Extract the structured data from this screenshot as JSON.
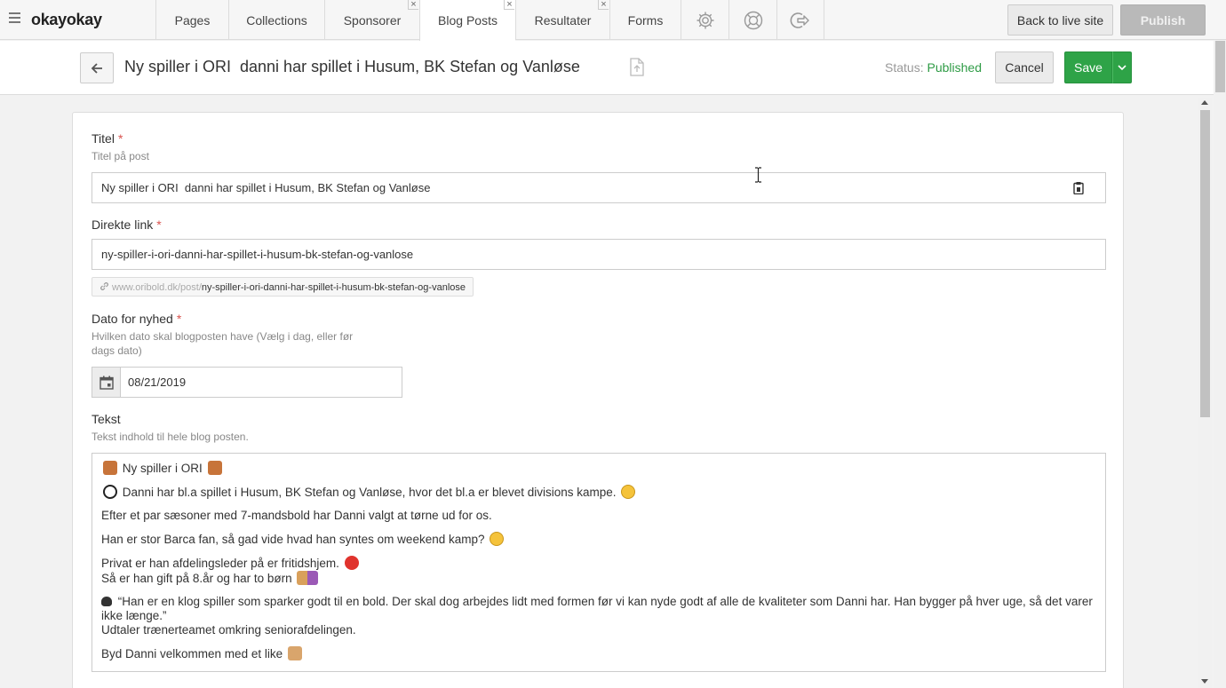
{
  "brand": "okayokay",
  "tabs": [
    {
      "label": "Pages",
      "closable": false
    },
    {
      "label": "Collections",
      "closable": false
    },
    {
      "label": "Sponsorer",
      "closable": true
    },
    {
      "label": "Blog Posts",
      "closable": true,
      "active": true
    },
    {
      "label": "Resultater",
      "closable": true
    },
    {
      "label": "Forms",
      "closable": false
    }
  ],
  "tab_icons": [
    "gear-icon",
    "lifebuoy-icon",
    "logout-icon"
  ],
  "top_actions": {
    "back_to_live": "Back to live site",
    "publish": "Publish"
  },
  "header": {
    "title": "Ny spiller i ORI  danni har spillet i Husum, BK Stefan og Vanløse",
    "status_label": "Status:",
    "status_value": "Published",
    "cancel": "Cancel",
    "save": "Save"
  },
  "form": {
    "title_label": "Titel",
    "title_hint": "Titel på post",
    "title_value": "Ny spiller i ORI  danni har spillet i Husum, BK Stefan og Vanløse",
    "link_label": "Direkte link",
    "link_value": "ny-spiller-i-ori-danni-har-spillet-i-husum-bk-stefan-og-vanlose",
    "link_preview_base": "www.oribold.dk/post/",
    "link_preview_slug": "ny-spiller-i-ori-danni-har-spillet-i-husum-bk-stefan-og-vanlose",
    "date_label": "Dato for nyhed",
    "date_hint_1": "Hvilken dato skal blogposten have (Vælg i dag, eller før",
    "date_hint_2": "dags dato)",
    "date_value": "08/21/2019",
    "text_label": "Tekst",
    "text_hint": "Tekst indhold til hele blog posten.",
    "editor_lines": {
      "l1": "Ny spiller i ORI",
      "l2": "Danni har bl.a spillet i Husum, BK Stefan og Vanløse, hvor det bl.a er blevet divisions kampe.",
      "l3": "Efter et par sæsoner med 7-mandsbold har Danni valgt at tørne ud for os.",
      "l4": "Han er stor Barca fan, så gad vide hvad han syntes om weekend kamp?",
      "l5a": "Privat er han afdelingsleder på er fritidshjem.",
      "l5b": "Så er han gift på 8.år og har to børn",
      "l6a": "“Han er en klog spiller som sparker godt til en bold. Der skal dog arbejdes lidt med formen før vi kan nyde godt af alle de kvaliteter som Danni har. Han bygger på hver uge, så det varer ikke længe.”",
      "l6b": "Udtaler trænerteamet omkring seniorafdelingen.",
      "l7": "Byd Danni velkommen med et like"
    }
  },
  "colors": {
    "save": "#2ea347",
    "status_published": "#2e9b45",
    "required": "#d9534f"
  }
}
